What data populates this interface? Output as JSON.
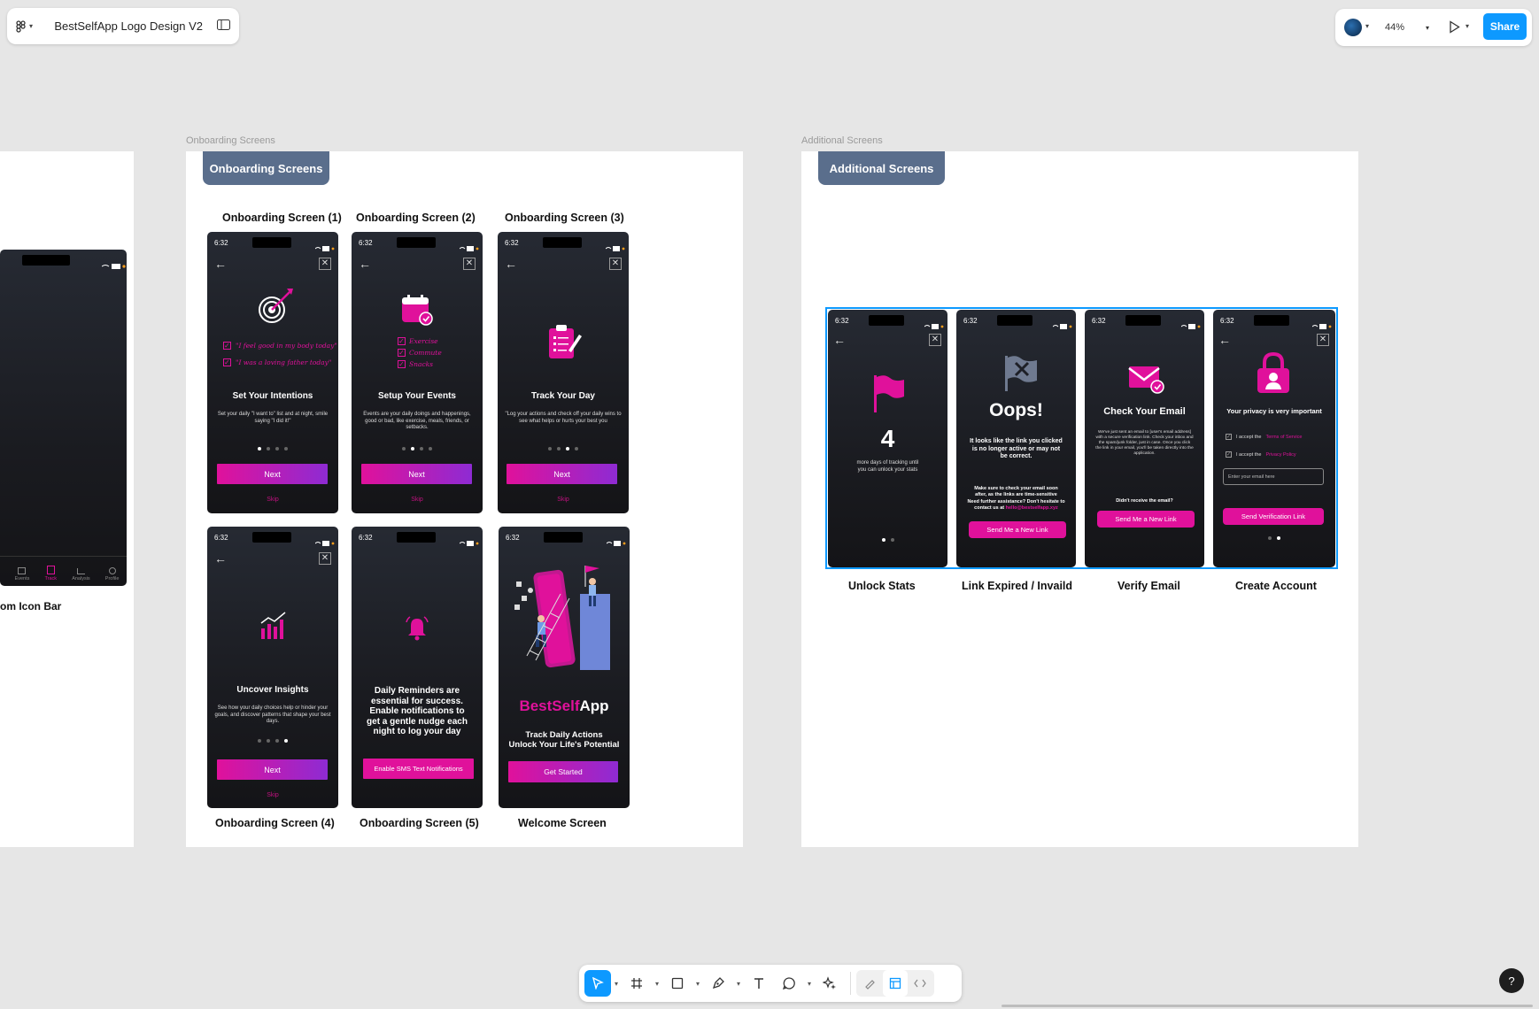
{
  "app": {
    "file_title": "BestSelfApp Logo Design V2",
    "zoom": "44%",
    "share_label": "Share",
    "help_label": "?"
  },
  "frames": {
    "onboarding_label": "Onboarding Screens",
    "additional_label": "Additional Screens"
  },
  "badges": {
    "onboarding": "Onboarding Screens",
    "additional": "Additional Screens"
  },
  "left_frame": {
    "caption": "om Icon Bar",
    "nav": [
      "Events",
      "Track",
      "Analysis",
      "Profile"
    ]
  },
  "status": {
    "time": "6:32"
  },
  "onboarding": {
    "caps": [
      "Onboarding Screen (1)",
      "Onboarding Screen (2)",
      "Onboarding Screen (3)",
      "Onboarding Screen (4)",
      "Onboarding Screen (5)",
      "Welcome Screen"
    ],
    "s1": {
      "title": "Set Your Intentions",
      "body": "Set your daily \"I want to\" list and at night, smile saying \"I did it!\"",
      "hand1": "\"I feel good in my body today\"",
      "hand2": "\"I was a loving father today\""
    },
    "s2": {
      "title": "Setup Your Events",
      "body": "Events are your daily doings and happenings, good or bad, like exercise, meals, friends, or setbacks.",
      "hand1": "Exercise",
      "hand2": "Commute",
      "hand3": "Snacks"
    },
    "s3": {
      "title": "Track Your Day",
      "body": "\"Log your actions and check off your daily wins to see what helps or hurts your best you"
    },
    "s4": {
      "title": "Uncover Insights",
      "body": "See how your daily choices help or hinder your goals, and discover patterns that shape your best days."
    },
    "s5": {
      "title": "Daily Reminders are essential for success. Enable notifications to get a gentle nudge each night to log your day",
      "button": "Enable SMS Text Notifications"
    },
    "welcome": {
      "brand1": "BestSelf",
      "brand2": "App",
      "tag1": "Track Daily Actions",
      "tag2": "Unlock Your Life's Potential",
      "button": "Get Started"
    },
    "next": "Next",
    "skip": "Skip"
  },
  "additional": {
    "caps": [
      "Unlock Stats",
      "Link Expired / Invaild",
      "Verify Email",
      "Create Account"
    ],
    "unlock": {
      "number": "4",
      "body": "more days of tracking until you can unlock your stats"
    },
    "oops": {
      "title": "Oops!",
      "body": "It looks like the link you clicked is no longer active or may not be correct.",
      "note1": "Make sure to check your email soon after, as the links are time-sensitive",
      "note2": "Need further assistance? Don't hesitate to contact us at",
      "email": "hello@bestselfapp.xyz",
      "button": "Send Me a New Link"
    },
    "verify": {
      "title": "Check Your Email",
      "body": "We've just sent an email to [user's email address] with a secure verification link. Check your inbox and the spam/junk folder, just in case. Once you click the link in your email, you'll be taken directly into the application.",
      "prompt": "Didn't receive the email?",
      "button": "Send Me a New Link"
    },
    "account": {
      "title": "Your privacy is very important",
      "check1": "I accept the",
      "link1": "Terms of Service",
      "check2": "I accept the",
      "link2": "Privacy Policy",
      "placeholder": "Enter your email here",
      "button": "Send Verification Link"
    }
  },
  "colors": {
    "brand_magenta": "#e0119b",
    "brand_purple": "#8e2bd3",
    "selection_blue": "#0d99ff",
    "badge": "#5a6e8c"
  }
}
